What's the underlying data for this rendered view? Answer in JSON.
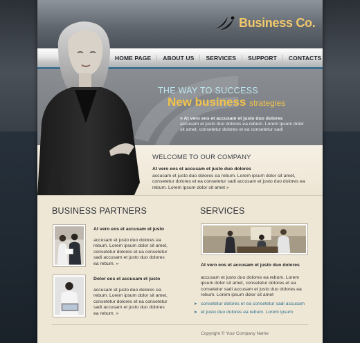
{
  "brand": {
    "name": "Business Co.",
    "accent": "#f3c96b"
  },
  "nav": {
    "items": [
      "HOME PAGE",
      "ABOUT US",
      "SERVICES",
      "SUPPORT",
      "CONTACTS"
    ]
  },
  "hero": {
    "tagline": "THE WAY TO SUCCESS",
    "headline_main": "New business",
    "headline_small": "strategies",
    "text_title": "At vero eos et accusam et justo duo dolores",
    "text_body": "accusam et justo duo dolores ea rebum. Lorem ipsum dolor sit amet, consetetur dolores et ea consetetur sadi"
  },
  "welcome": {
    "title": "WELCOME TO OUR COMPANY",
    "heading": "At vero eos et accusam et justo duo dolores",
    "body": "accusam et justo duo dolores ea rebum. Lorem ipsum dolor sit amet, consetetur dolores et ea consetetur sadi accusam et justo duo dolores ea rebum. Lorem ipsum dolor sit amet"
  },
  "partners": {
    "title": "BUSINESS PARTNERS",
    "items": [
      {
        "title": "At vero eos et accusam et justo",
        "body": "accusam et justo duo dolores ea rebum. Lorem ipsum dolor sit amet, consetetur dolores et ea consetetur sadi accusam et justo duo dolores ea rebum."
      },
      {
        "title": "Dolor eos et accusam et justo",
        "body": "accusam et justo duo dolores ea rebum. Lorem ipsum dolor sit amet, consetetur dolores et ea consetetur sadi accusam et justo duo dolores ea rebum."
      }
    ]
  },
  "services": {
    "title": "SERVICES",
    "heading": "At vero eos et accusam et justo duo dolores",
    "body": "accusam et justo duo dolores ea rebum. Lorem ipsum dolor sit amet, consetetur dolores et ea consetetur sadi accusam et justo duo dolores ea rebum. Lorem ipsum dolor sit amet",
    "links": [
      "consetetur dolores et ea consetetur sadi accusam",
      "et justo duo dolores ea rebum. Lorem ipsum"
    ]
  },
  "footer": {
    "copyright": "Copyright © Your Company Name"
  }
}
